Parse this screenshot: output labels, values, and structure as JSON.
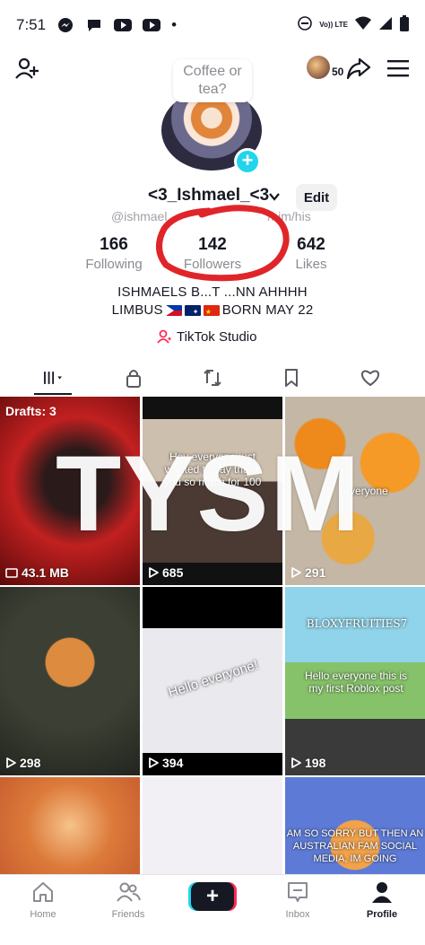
{
  "status_bar": {
    "time": "7:51",
    "network_label": "Vo)) LTE"
  },
  "topbar": {
    "avatar_count": "50"
  },
  "note_bubble": {
    "line1": "Coffee or",
    "line2": "tea?"
  },
  "profile": {
    "username": "<3_Ishmael_<3",
    "edit_label": "Edit",
    "handle": "@ishmael",
    "pronouns": "/him/his",
    "following_count": "166",
    "following_label": "Following",
    "followers_count": "142",
    "followers_label": "Followers",
    "likes_count": "642",
    "likes_label": "Likes",
    "bio_line1": "ISHMAELS B...T ...NN AHHHH",
    "bio_line2_prefix": "LIMBUS",
    "bio_line2_suffix": "BORN MAY 22",
    "studio_label": "TikTok Studio"
  },
  "overlay_text": "TYSM",
  "grid": {
    "drafts_label": "Drafts: 3",
    "items": [
      {
        "count": "43.1 MB",
        "caption": ""
      },
      {
        "count": "685",
        "caption": "Hey everyone just wanted to say thank you so much for 100"
      },
      {
        "count": "291",
        "caption": "everyone"
      },
      {
        "count": "298",
        "caption": ""
      },
      {
        "count": "394",
        "caption": "Hello everyone!"
      },
      {
        "count": "198",
        "caption": "Hello everyone this is my first Roblox post",
        "title": "BLOXYFRUITIES7"
      },
      {
        "count": "",
        "caption": ""
      },
      {
        "count": "",
        "caption": ""
      },
      {
        "count": "",
        "caption": "AM SO SORRY BUT THEN AN AUSTRALIAN FAM SOCIAL MEDIA, IM GOING"
      }
    ]
  },
  "bottom_nav": {
    "home": "Home",
    "friends": "Friends",
    "inbox": "Inbox",
    "profile": "Profile",
    "create_symbol": "+"
  },
  "colors": {
    "accent_cyan": "#20d5ec",
    "accent_red": "#fe2c55",
    "annotation_red": "#e0252a",
    "text_primary": "#161823",
    "text_muted": "#8a8b91"
  },
  "icons": [
    "messenger-icon",
    "chat-icon",
    "youtube-icon",
    "wifi-icon",
    "signal-icon",
    "battery-icon",
    "add-friend-icon",
    "share-icon",
    "menu-icon",
    "plus-icon",
    "chevron-down-icon",
    "grid-icon",
    "lock-icon",
    "repost-icon",
    "bookmark-icon",
    "heart-icon",
    "play-icon",
    "home-icon",
    "friends-icon",
    "inbox-icon",
    "profile-icon"
  ]
}
